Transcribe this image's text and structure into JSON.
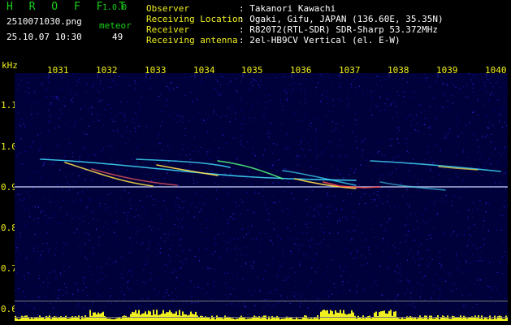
{
  "header": {
    "app_title": "H R O F F T",
    "version": "1.0.0",
    "filename": "2510071030.png",
    "timestamp": "25.10.07 10:30",
    "count_label": "meteor",
    "count_value": "49"
  },
  "info": {
    "labels": [
      "Observer",
      "Receiving Location",
      "Receiver",
      "Receiving antenna"
    ],
    "values": [
      ": Takanori Kawachi",
      ": Ogaki, Gifu, JAPAN (136.60E, 35.35N)",
      ": R820T2(RTL-SDR) SDR-Sharp 53.372MHz",
      ": 2el-HB9CV Vertical (el. E-W)"
    ]
  },
  "axes": {
    "unit": "kHz",
    "time_ticks": [
      "1031",
      "1032",
      "1033",
      "1034",
      "1035",
      "1036",
      "1037",
      "1038",
      "1039",
      "1040"
    ],
    "freq_ticks": [
      "1.1",
      "1.0",
      "0.9",
      "0.8",
      "0.7",
      "0.6"
    ]
  },
  "colors": {
    "background": "#00003a",
    "carrier": "#ffffff",
    "meteor": "#40e0ff",
    "level_bar": "#f0f020",
    "label_green": "#19d219"
  }
}
